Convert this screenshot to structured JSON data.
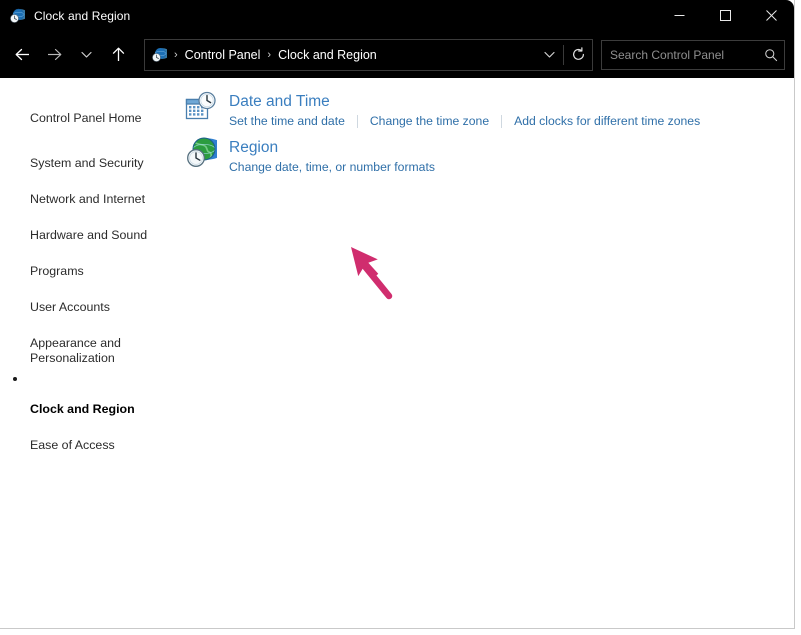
{
  "window": {
    "title": "Clock and Region",
    "title_icon": "region-globe-clock-icon",
    "controls": {
      "minimize_label": "Minimize",
      "maximize_label": "Maximize",
      "close_label": "Close"
    }
  },
  "navbar": {
    "back_label": "Back",
    "forward_label": "Forward",
    "recent_label": "Recent locations",
    "up_label": "Up",
    "refresh_label": "Refresh",
    "breadcrumb": [
      "Control Panel",
      "Clock and Region"
    ],
    "breadcrumb_separator": "›",
    "breadcrumb_icon": "control-panel-icon"
  },
  "search": {
    "placeholder": "Search Control Panel",
    "value": "",
    "icon": "search-icon"
  },
  "sidebar": {
    "items": [
      {
        "label": "Control Panel Home",
        "current": false
      },
      {
        "label": "System and Security",
        "current": false
      },
      {
        "label": "Network and Internet",
        "current": false
      },
      {
        "label": "Hardware and Sound",
        "current": false
      },
      {
        "label": "Programs",
        "current": false
      },
      {
        "label": "User Accounts",
        "current": false
      },
      {
        "label": "Appearance and\nPersonalization",
        "current": false
      },
      {
        "label": "Clock and Region",
        "current": true
      },
      {
        "label": "Ease of Access",
        "current": false
      }
    ]
  },
  "main": {
    "categories": [
      {
        "title": "Date and Time",
        "icon": "calendar-clock-icon",
        "links": [
          "Set the time and date",
          "Change the time zone",
          "Add clocks for different time zones"
        ]
      },
      {
        "title": "Region",
        "icon": "globe-clock-icon",
        "links": [
          "Change date, time, or number formats"
        ]
      }
    ]
  },
  "annotation": {
    "type": "arrow-cursor",
    "color": "#d02d6e",
    "points_at": "Change date, time, or number formats"
  },
  "colors": {
    "titlebar_bg": "#000000",
    "content_bg": "#ffffff",
    "category_title": "#3a7ebf",
    "category_link": "#2f6fa8",
    "sidebar_text": "#2b2b2b",
    "annotation": "#d02d6e"
  }
}
